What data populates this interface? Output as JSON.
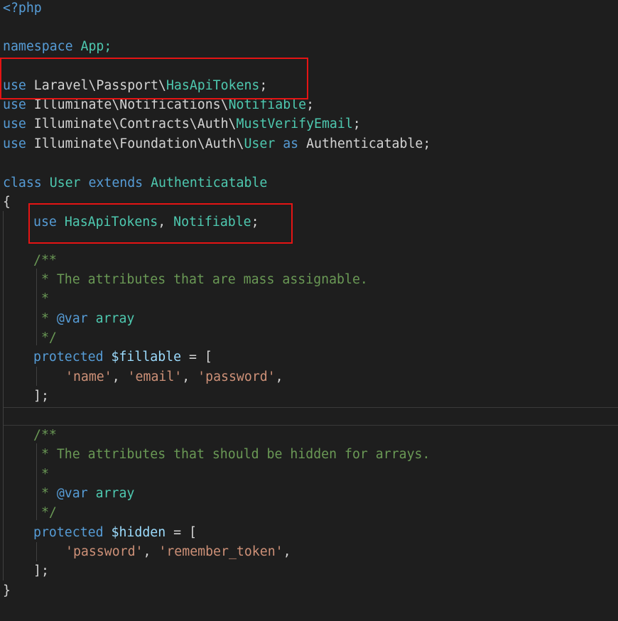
{
  "code": {
    "l1": [
      "<?php"
    ],
    "l3": [
      "namespace",
      " App;"
    ],
    "l5": [
      "use",
      " Laravel\\Passport\\",
      "HasApiTokens",
      ";"
    ],
    "l6": [
      "use",
      " Illuminate\\Notifications\\",
      "Notifiable",
      ";"
    ],
    "l7": [
      "use",
      " Illuminate\\Contracts\\Auth\\",
      "MustVerifyEmail",
      ";"
    ],
    "l8": [
      "use",
      " Illuminate\\Foundation\\Auth\\",
      "User",
      " as ",
      "Authenticatable;"
    ],
    "l10": [
      "class",
      " ",
      "User",
      " ",
      "extends",
      " ",
      "Authenticatable"
    ],
    "l11": [
      "{"
    ],
    "l12": [
      "use",
      " ",
      "HasApiTokens",
      ", ",
      "Notifiable",
      ";"
    ],
    "l14": [
      "/**"
    ],
    "l15": [
      " * The attributes that are mass assignable."
    ],
    "l16": [
      " *"
    ],
    "l17": [
      " * ",
      "@var",
      " ",
      "array"
    ],
    "l18": [
      " */"
    ],
    "l19": [
      "protected",
      " ",
      "$fillable",
      " = ["
    ],
    "l20": [
      "'name'",
      ", ",
      "'email'",
      ", ",
      "'password'",
      ","
    ],
    "l21": [
      "];"
    ],
    "l24": [
      "/**"
    ],
    "l25": [
      " * The attributes that should be hidden for arrays."
    ],
    "l26": [
      " *"
    ],
    "l27": [
      " * ",
      "@var",
      " ",
      "array"
    ],
    "l28": [
      " */"
    ],
    "l29": [
      "protected",
      " ",
      "$hidden",
      " = ["
    ],
    "l30": [
      "'password'",
      ", ",
      "'remember_token'",
      ","
    ],
    "l31": [
      "];"
    ],
    "l32": [
      "}"
    ]
  },
  "colors": {
    "background": "#1e1e1e",
    "keyword": "#569cd6",
    "type": "#4ec9b0",
    "variable": "#9cdcfe",
    "string": "#ce9178",
    "comment": "#6a9955",
    "plain": "#d4d4d4",
    "highlight_box": "#e51414"
  }
}
